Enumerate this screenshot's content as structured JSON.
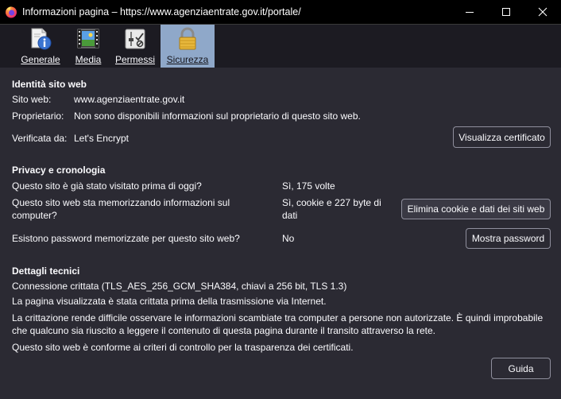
{
  "window": {
    "title": "Informazioni pagina – https://www.agenziaentrate.gov.it/portale/"
  },
  "tabs": [
    {
      "label": "Generale",
      "icon": "page-info-icon"
    },
    {
      "label": "Media",
      "icon": "media-icon"
    },
    {
      "label": "Permessi",
      "icon": "permissions-icon"
    },
    {
      "label": "Sicurezza",
      "icon": "lock-icon",
      "selected": true
    }
  ],
  "identity": {
    "heading": "Identità sito web",
    "site_label": "Sito web:",
    "site_value": "www.agenziaentrate.gov.it",
    "owner_label": "Proprietario:",
    "owner_value": "Non sono disponibili informazioni sul proprietario di questo sito web.",
    "verified_label": "Verificata da:",
    "verified_value": "Let's Encrypt",
    "view_cert_button": "Visualizza certificato"
  },
  "privacy": {
    "heading": "Privacy e cronologia",
    "visited_question": "Questo sito è già stato visitato prima di oggi?",
    "visited_answer": "Sì, 175 volte",
    "storing_question": "Questo sito web sta memorizzando informazioni sul computer?",
    "storing_answer": "Sì, cookie e 227 byte di dati",
    "clear_button": "Elimina cookie e dati dei siti web",
    "passwords_question": "Esistono password memorizzate per questo sito web?",
    "passwords_answer": "No",
    "show_passwords_button": "Mostra password"
  },
  "technical": {
    "heading": "Dettagli tecnici",
    "connection": "Connessione crittata (TLS_AES_256_GCM_SHA384, chiavi a 256 bit, TLS 1.3)",
    "encrypted_note": "La pagina visualizzata è stata crittata prima della trasmissione via Internet.",
    "encryption_explanation": "La crittazione rende difficile osservare le informazioni scambiate tra computer a persone non autorizzate. È quindi improbabile che qualcuno sia riuscito a leggere il contenuto di questa pagina durante il transito attraverso la rete.",
    "transparency": "Questo sito web è conforme ai criteri di controllo per la trasparenza dei certificati."
  },
  "help_button": "Guida"
}
